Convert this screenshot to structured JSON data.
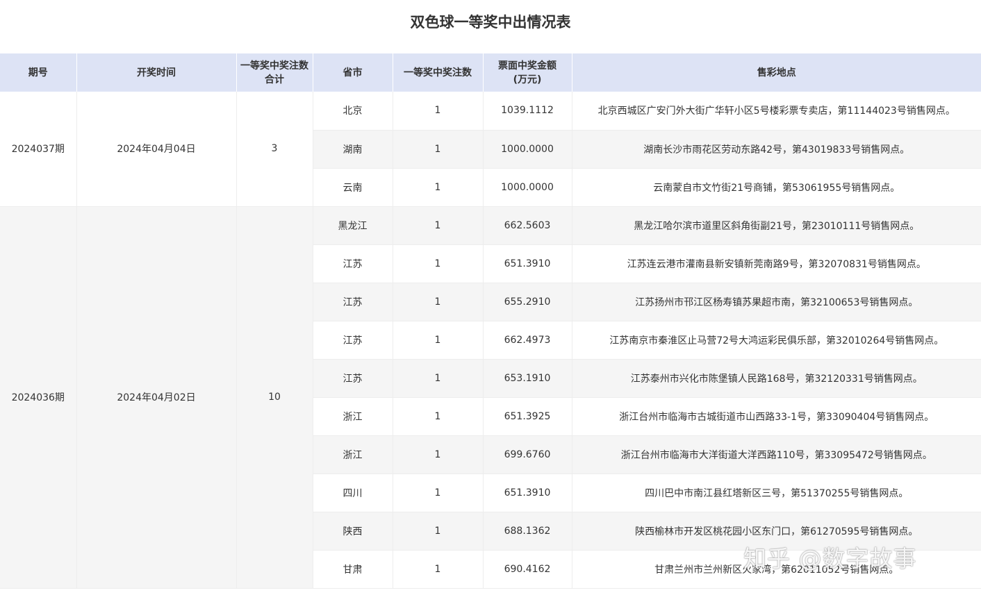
{
  "title": "双色球一等奖中出情况表",
  "columns": {
    "issue": "期号",
    "draw_date": "开奖时间",
    "total_line1": "一等奖中奖注数",
    "total_line2": "合计",
    "province": "省市",
    "count": "一等奖中奖注数",
    "amount_line1": "票面中奖金额",
    "amount_line2": "(万元)",
    "location": "售彩地点"
  },
  "groups": [
    {
      "issue": "2024037期",
      "draw_date": "2024年04月04日",
      "total": "3",
      "rows": [
        {
          "province": "北京",
          "count": "1",
          "amount": "1039.1112",
          "location": "北京西城区广安门外大街广华轩小区5号楼彩票专卖店，第11144023号销售网点。"
        },
        {
          "province": "湖南",
          "count": "1",
          "amount": "1000.0000",
          "location": "湖南长沙市雨花区劳动东路42号，第43019833号销售网点。"
        },
        {
          "province": "云南",
          "count": "1",
          "amount": "1000.0000",
          "location": "云南蒙自市文竹街21号商铺，第53061955号销售网点。"
        }
      ]
    },
    {
      "issue": "2024036期",
      "draw_date": "2024年04月02日",
      "total": "10",
      "rows": [
        {
          "province": "黑龙江",
          "count": "1",
          "amount": "662.5603",
          "location": "黑龙江哈尔滨市道里区斜角街副21号，第23010111号销售网点。"
        },
        {
          "province": "江苏",
          "count": "1",
          "amount": "651.3910",
          "location": "江苏连云港市灌南县新安镇新莞南路9号，第32070831号销售网点。"
        },
        {
          "province": "江苏",
          "count": "1",
          "amount": "655.2910",
          "location": "江苏扬州市邗江区杨寿镇苏果超市南，第32100653号销售网点。"
        },
        {
          "province": "江苏",
          "count": "1",
          "amount": "662.4973",
          "location": "江苏南京市秦淮区止马营72号大鸿运彩民俱乐部，第32010264号销售网点。"
        },
        {
          "province": "江苏",
          "count": "1",
          "amount": "653.1910",
          "location": "江苏泰州市兴化市陈堡镇人民路168号，第32120331号销售网点。"
        },
        {
          "province": "浙江",
          "count": "1",
          "amount": "651.3925",
          "location": "浙江台州市临海市古城街道市山西路33-1号，第33090404号销售网点。"
        },
        {
          "province": "浙江",
          "count": "1",
          "amount": "699.6760",
          "location": "浙江台州市临海市大洋街道大洋西路110号，第33095472号销售网点。"
        },
        {
          "province": "四川",
          "count": "1",
          "amount": "651.3910",
          "location": "四川巴中市南江县红塔新区三号，第51370255号销售网点。"
        },
        {
          "province": "陕西",
          "count": "1",
          "amount": "688.1362",
          "location": "陕西榆林市开发区桃花园小区东门口，第61270595号销售网点。"
        },
        {
          "province": "甘肃",
          "count": "1",
          "amount": "690.4162",
          "location": "甘肃兰州市兰州新区火家湾，第62011052号销售网点。"
        }
      ]
    }
  ],
  "watermark": "知乎 @数字故事"
}
